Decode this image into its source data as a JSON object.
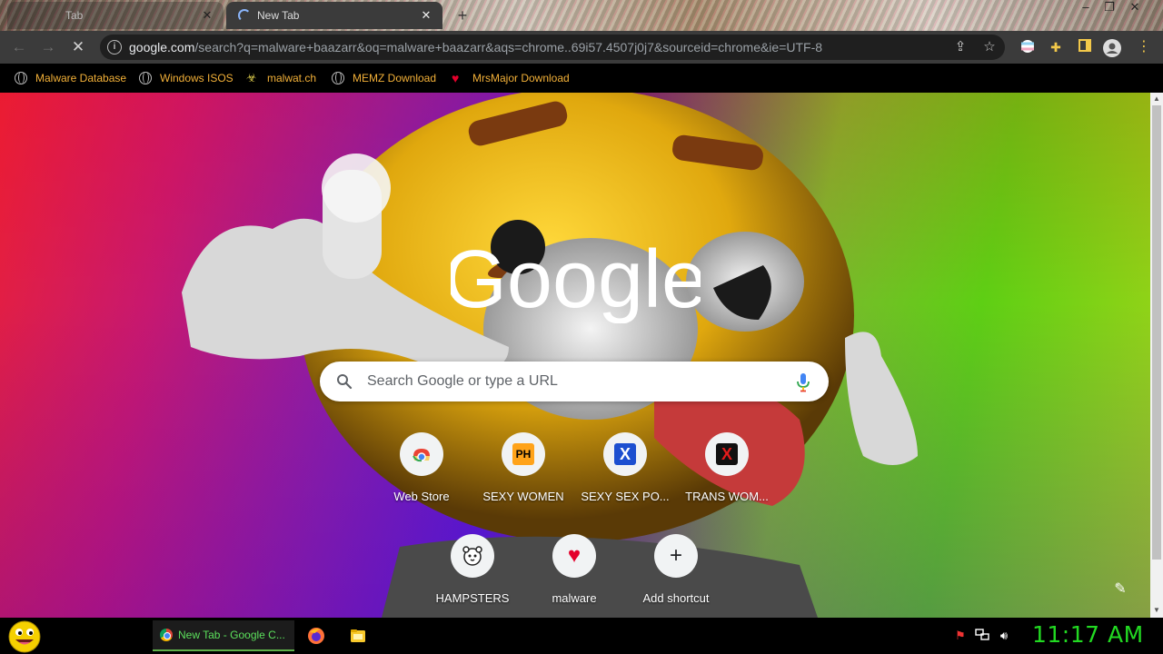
{
  "browser": {
    "tabs": [
      {
        "label": "Tab",
        "active": false
      },
      {
        "label": "New Tab",
        "active": true
      }
    ],
    "new_tab_symbol": "+",
    "url_host": "google.com",
    "url_rest": "/search?q=malware+baazarr&oq=malware+baazarr&aqs=chrome..69i57.4507j0j7&sourceid=chrome&ie=UTF-8"
  },
  "bookmarks": [
    {
      "label": "Malware Database",
      "icon": "globe-icon"
    },
    {
      "label": "Windows ISOS",
      "icon": "globe-icon"
    },
    {
      "label": "malwat.ch",
      "icon": "biohazard-icon"
    },
    {
      "label": "MEMZ Download",
      "icon": "globe-icon"
    },
    {
      "label": "MrsMajor Download",
      "icon": "heart-icon"
    }
  ],
  "newtab": {
    "logo_text": "Google",
    "search_placeholder": "Search Google or type a URL",
    "shortcuts": [
      {
        "label": "Web Store",
        "icon": "web-store-icon"
      },
      {
        "label": "SEXY WOMEN",
        "icon": "ph-icon",
        "icon_text": "PH"
      },
      {
        "label": "SEXY SEX PO...",
        "icon": "x-blue-icon",
        "icon_text": "X"
      },
      {
        "label": "TRANS WOM...",
        "icon": "x-red-icon",
        "icon_text": "X"
      },
      {
        "label": "HAMPSTERS",
        "icon": "hamster-icon"
      },
      {
        "label": "malware",
        "icon": "heart-icon"
      },
      {
        "label": "Add shortcut",
        "icon": "plus-icon",
        "icon_text": "+"
      }
    ]
  },
  "taskbar": {
    "active_task_label": "New Tab - Google C...",
    "clock": "11:17 AM"
  },
  "colors": {
    "bookmark_text": "#f2b038",
    "clock": "#22d922",
    "task_text": "#5ce05c"
  }
}
